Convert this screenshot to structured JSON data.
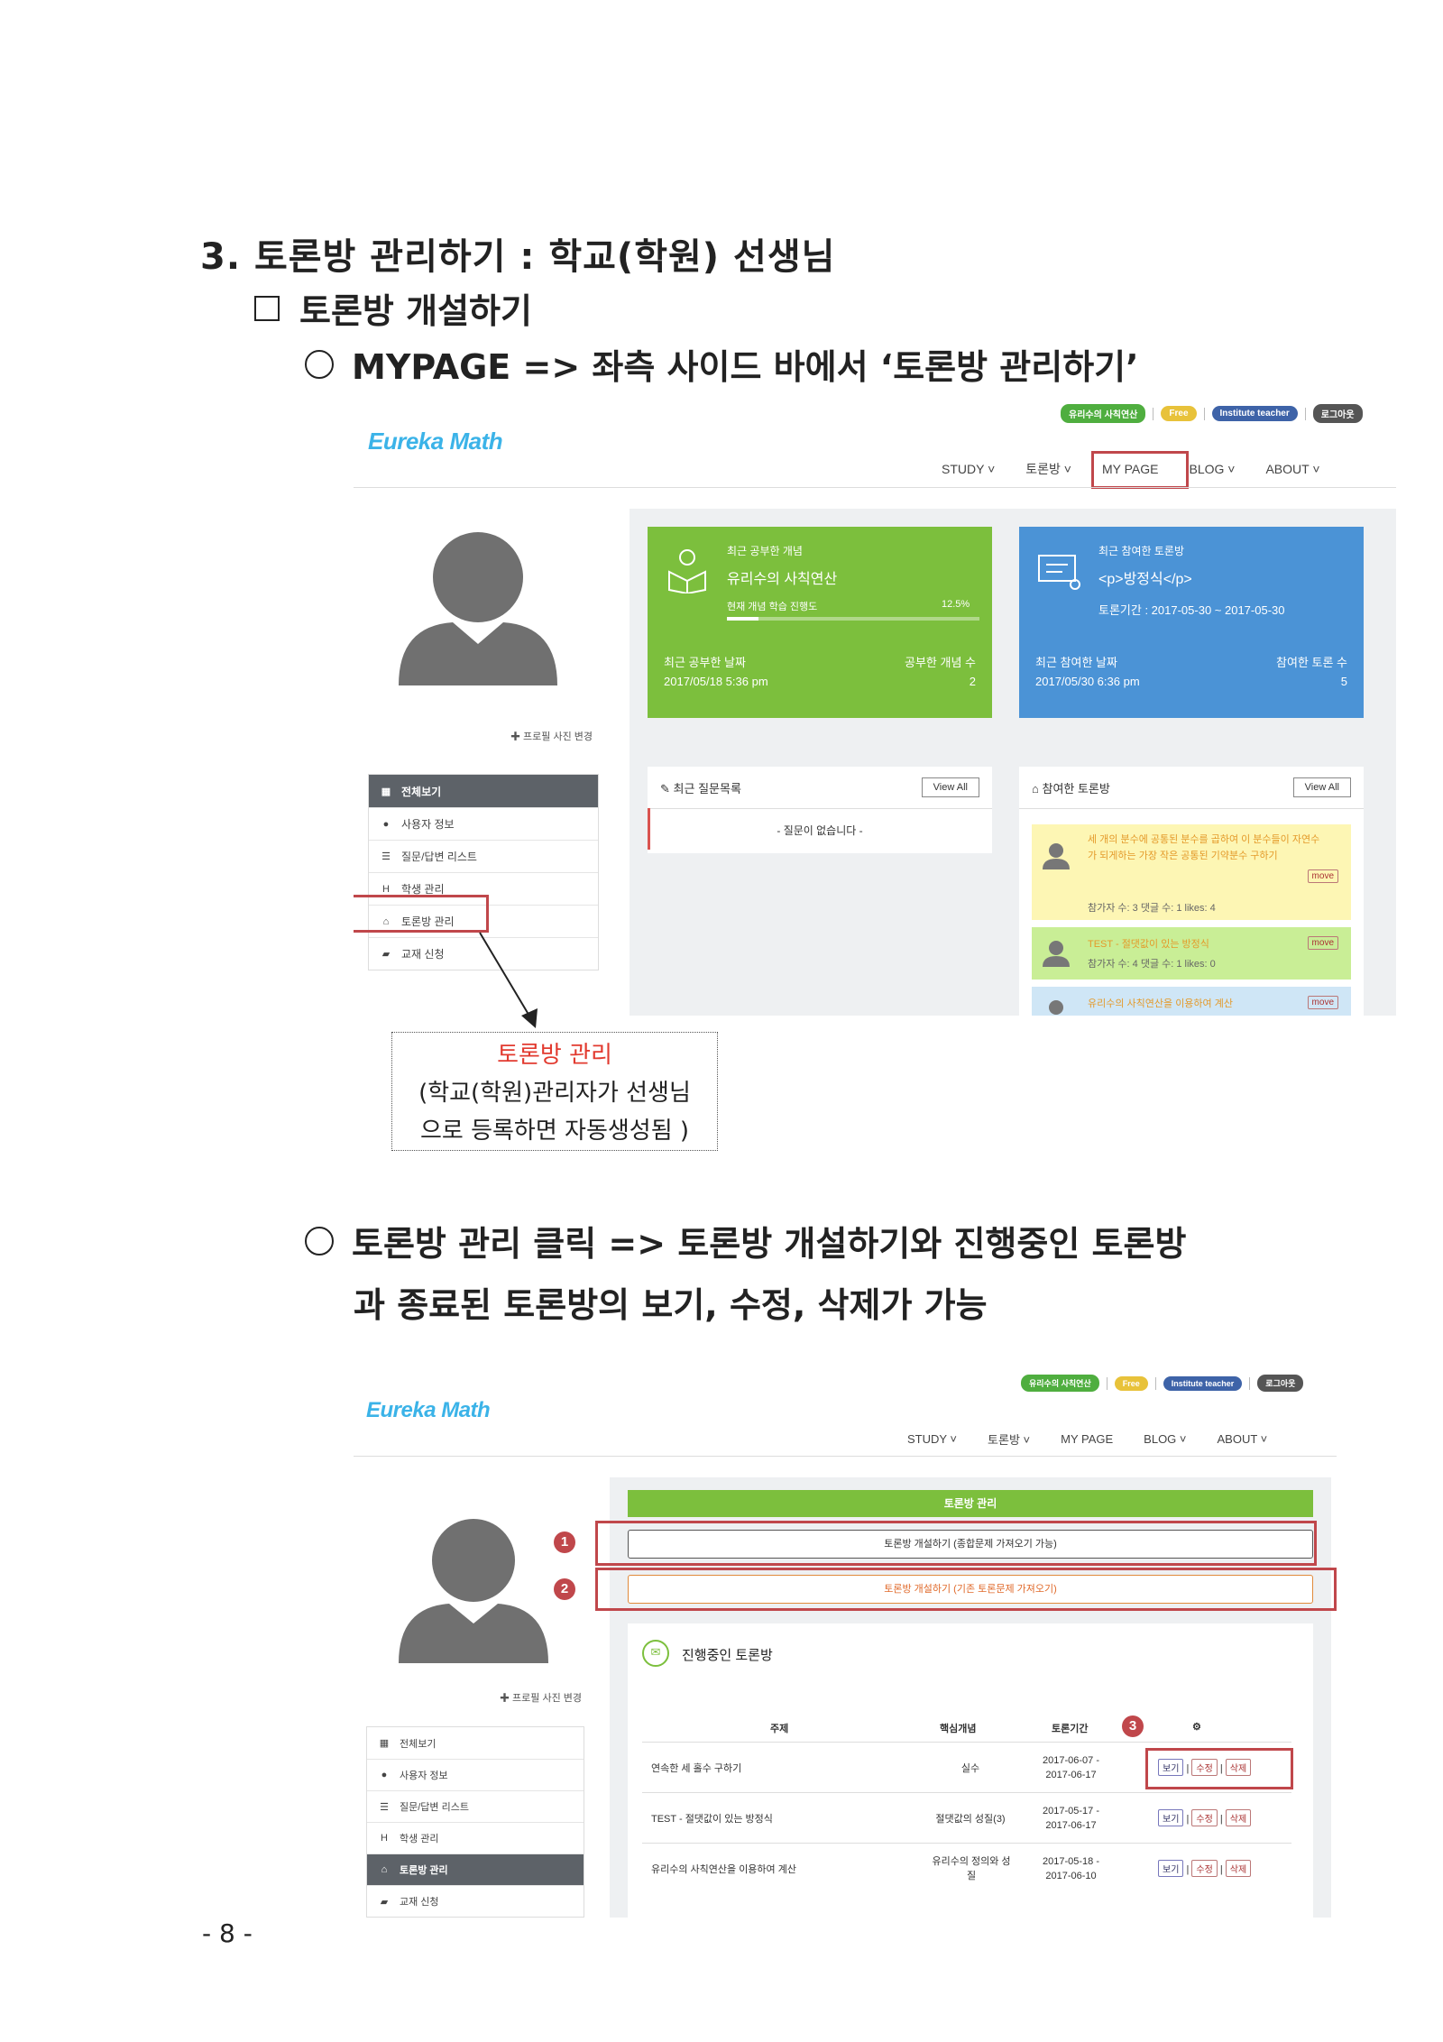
{
  "heading": {
    "section": "3. 토론방 관리하기 : 학교(학원) 선생님",
    "sub": "토론방 개설하기",
    "step1": "MYPAGE => 좌측 사이드 바에서 ‘토론방 관리하기’",
    "step2_line1": "토론방 관리 클릭 => 토론방 개설하기와 진행중인 토론방",
    "step2_line2": "과 종료된 토론방의 보기, 수정, 삭제가 가능"
  },
  "shot1": {
    "logo": "Eureka Math",
    "pills": [
      "유리수의 사칙연산",
      "Free",
      "Institute teacher",
      "로그아웃"
    ],
    "nav": [
      "STUDY ˅",
      "토론방 ˅",
      "MY PAGE",
      "BLOG ˅",
      "ABOUT ˅"
    ],
    "profile_link": "✚ 프로필 사진 변경",
    "menu": [
      "전체보기",
      "사용자 정보",
      "질문/답변 리스트",
      "학생 관리",
      "토론방 관리",
      "교재 신청"
    ],
    "card_green": {
      "label": "최근 공부한 개념",
      "title": "유리수의 사칙연산",
      "progress_label": "현재 개념 학습 진행도",
      "progress_value": "12.5%",
      "progress": 0.125,
      "date_label": "최근 공부한 날짜",
      "date": "2017/05/18 5:36 pm",
      "count_label": "공부한 개념 수",
      "count": "2"
    },
    "card_blue": {
      "label": "최근 참여한 토론방",
      "title": "<p>방정식</p>",
      "period": "토론기간 : 2017-05-30 ~ 2017-05-30",
      "date_label": "최근 참여한 날짜",
      "date": "2017/05/30 6:36 pm",
      "count_label": "참여한 토론 수",
      "count": "5"
    },
    "questions": {
      "title": "최근 질문목록",
      "view_all": "View All",
      "empty": "- 질문이 없습니다 -"
    },
    "rooms": {
      "title": "참여한 토론방",
      "view_all": "View All",
      "items": [
        {
          "text": "세 개의 분수에 공통된 분수를 곱하여 이 분수들이 자연수가 되게하는 가장 작은 공통된 기약분수 구하기",
          "meta": "참가자 수: 3   댓글 수: 1   likes: 4",
          "btn": "move"
        },
        {
          "text": "TEST - 절댓값이 있는 방정식",
          "meta": "참가자 수: 4   댓글 수: 1   likes: 0",
          "btn": "move"
        },
        {
          "text": "유리수의 사칙연산을 이용하여 계산",
          "meta": "",
          "btn": "move"
        }
      ]
    }
  },
  "note": {
    "title": "토론방 관리",
    "line1": "(학교(학원)관리자가 선생님",
    "line2": "으로 등록하면 자동생성됨 )"
  },
  "shot2": {
    "logo": "Eureka Math",
    "pills": [
      "유리수의 사칙연산",
      "Free",
      "Institute teacher",
      "로그아웃"
    ],
    "nav": [
      "STUDY ˅",
      "토론방 ˅",
      "MY PAGE",
      "BLOG ˅",
      "ABOUT ˅"
    ],
    "profile_link": "✚ 프로필 사진 변경",
    "menu": [
      "전체보기",
      "사용자 정보",
      "질문/답변 리스트",
      "학생 관리",
      "토론방 관리",
      "교재 신청"
    ],
    "bar_title": "토론방 관리",
    "btn_new": "토론방 개설하기 (종합문제 가져오기 가능)",
    "btn_old": "토론방 개설하기 (기존 토론문제 가져오기)",
    "ongoing": "진행중인 토론방",
    "headers": [
      "주제",
      "핵심개념",
      "토론기간",
      "⚙"
    ],
    "rows": [
      {
        "topic": "연속한 세 홀수 구하기",
        "concept": "실수",
        "period1": "2017-06-07 -",
        "period2": "2017-06-17"
      },
      {
        "topic": "TEST - 절댓값이 있는 방정식",
        "concept": "절댓값의 성질(3)",
        "period1": "2017-05-17 -",
        "period2": "2017-06-17"
      },
      {
        "topic": "유리수의 사칙연산을 이용하여 계산",
        "concept": "유리수의 정의와 성질",
        "period1": "2017-05-18 -",
        "period2": "2017-06-10"
      }
    ],
    "actions": [
      "보기",
      "수정",
      "삭제"
    ],
    "markers": [
      "1",
      "2",
      "3"
    ]
  },
  "page_number": "- 8 -"
}
